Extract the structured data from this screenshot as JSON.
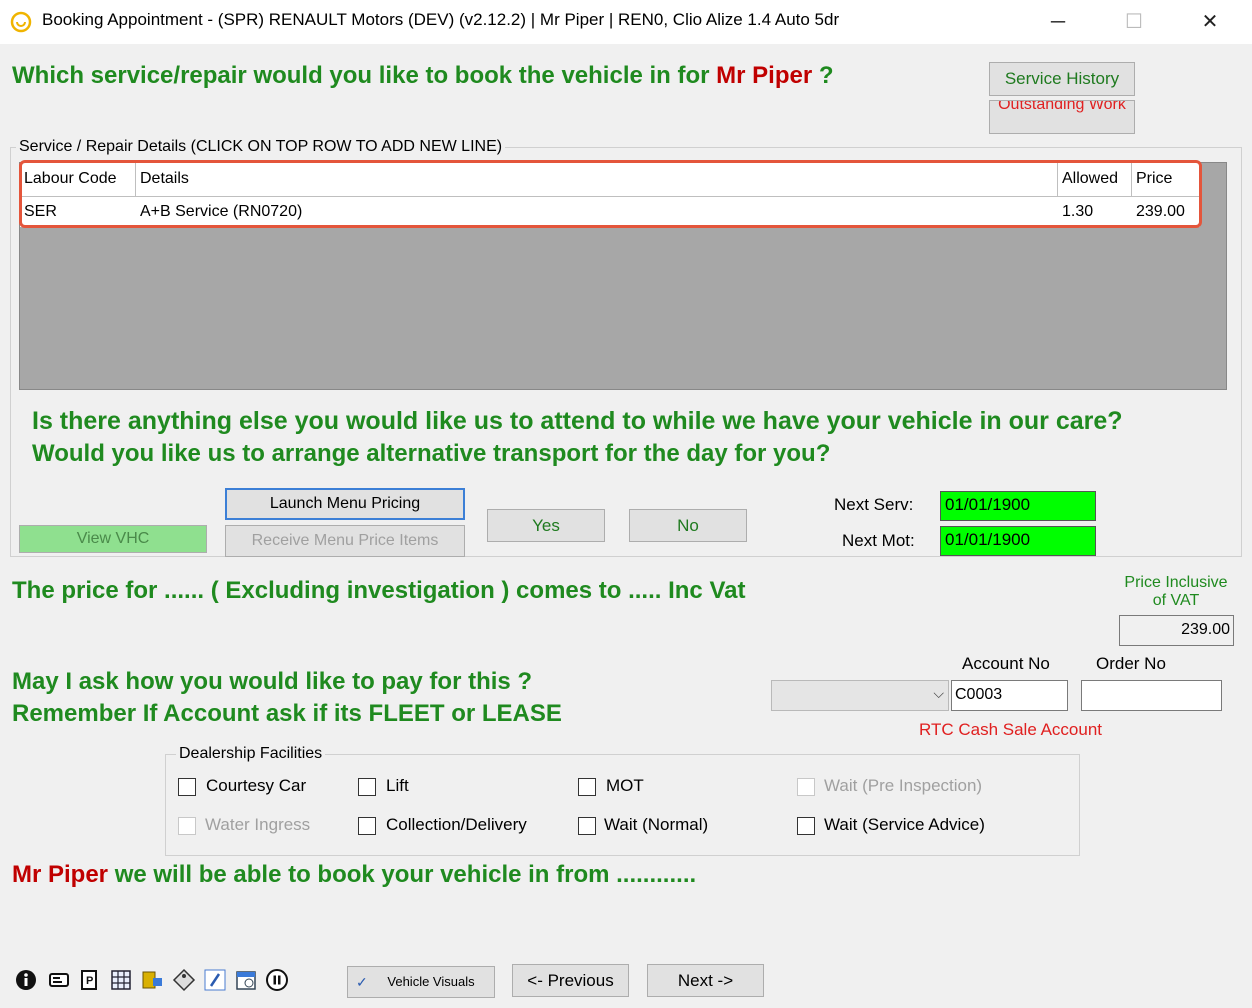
{
  "window": {
    "title": "Booking Appointment - (SPR) RENAULT Motors (DEV) (v2.12.2) | Mr Piper | REN0, Clio Alize 1.4 Auto 5dr",
    "minimize": "─",
    "maximize": "☐",
    "close": "✕"
  },
  "question1": {
    "prefix": "Which service/repair would you like to book the vehicle in for ",
    "customer": "Mr Piper",
    "suffix": " ?"
  },
  "buttons": {
    "service_history": "Service History",
    "outstanding_work": "Outstanding Work",
    "launch_menu_pricing": "Launch Menu Pricing",
    "receive_menu_price_items": "Receive Menu Price Items",
    "view_vhc": "View VHC",
    "yes": "Yes",
    "no": "No",
    "vehicle_visuals": "Vehicle Visuals",
    "previous": "<- Previous",
    "next": "Next ->"
  },
  "service_group": {
    "label": "Service / Repair Details    (CLICK ON TOP ROW TO ADD NEW LINE)",
    "columns": [
      "Labour Code",
      "Details",
      "Allowed",
      "Price"
    ],
    "rows": [
      {
        "labour_code": "SER",
        "details": "A+B Service (RN0720)",
        "allowed": "1.30",
        "price": "239.00"
      }
    ]
  },
  "question2": {
    "line1": "Is there anything else you would like us to attend to while we have your vehicle in our care?",
    "line2": "Would you like us to arrange alternative transport for the day for you?"
  },
  "next_dates": {
    "serv_label": "Next Serv:",
    "serv_value": "01/01/1900",
    "mot_label": "Next Mot:",
    "mot_value": "01/01/1900"
  },
  "price_statement": "The price for ...... ( Excluding investigation ) comes to ..... Inc Vat",
  "price_inc_vat": {
    "label_line1": "Price Inclusive",
    "label_line2": "of VAT",
    "value": "239.00"
  },
  "payment": {
    "line1": "May I ask how you would like to pay for this ?",
    "line2": "Remember If Account  ask if its FLEET or LEASE",
    "account_no_label": "Account No",
    "account_no_value": "C0003",
    "order_no_label": "Order No",
    "order_no_value": "",
    "account_type": "",
    "account_name": "RTC Cash Sale Account"
  },
  "facilities": {
    "label": "Dealership Facilities",
    "items": [
      {
        "label": "Courtesy Car",
        "enabled": true
      },
      {
        "label": "Lift",
        "enabled": true
      },
      {
        "label": "MOT",
        "enabled": true
      },
      {
        "label": "Wait (Pre Inspection)",
        "enabled": false
      },
      {
        "label": "Water Ingress",
        "enabled": false
      },
      {
        "label": "Collection/Delivery",
        "enabled": true
      },
      {
        "label": "Wait (Normal)",
        "enabled": true
      },
      {
        "label": "Wait (Service Advice)",
        "enabled": true
      }
    ]
  },
  "booking_statement": {
    "customer": "Mr Piper",
    "text": " we will be able to book your vehicle in from ............"
  },
  "colors": {
    "question_green": "#1f8a1f",
    "customer_red": "#c00000",
    "date_field": "#00ff00",
    "highlight": "#e4553b",
    "grid_bg": "#a7a7a7"
  },
  "toolbar_icons": [
    "info-icon",
    "id-card-icon",
    "parking-icon",
    "grid-icon",
    "car-key-icon",
    "tag-icon",
    "pen-icon",
    "calendar-icon",
    "pause-icon"
  ]
}
